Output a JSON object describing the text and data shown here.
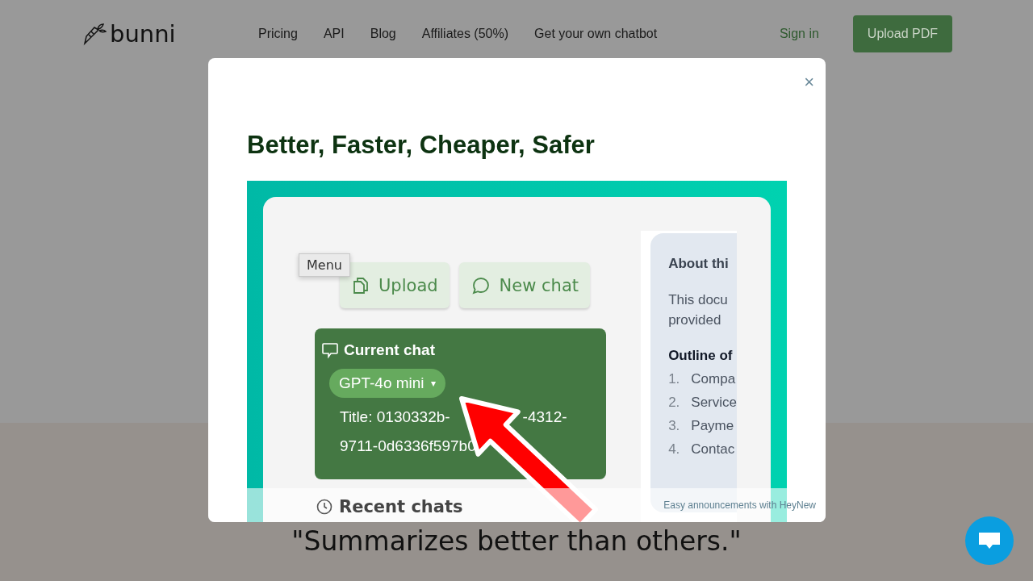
{
  "header": {
    "logo": "bunni",
    "nav": [
      "Pricing",
      "API",
      "Blog",
      "Affiliates (50%)",
      "Get your own chatbot"
    ],
    "sign_in": "Sign in",
    "upload_button": "Upload PDF"
  },
  "modal": {
    "close": "×",
    "title": "Better, Faster, Cheaper, Safer",
    "screenshot": {
      "menu_tooltip": "Menu",
      "buttons": [
        {
          "label": "Upload",
          "kind": "upload"
        },
        {
          "label": "New chat",
          "kind": "chat"
        }
      ],
      "current_chat": {
        "heading": "Current chat",
        "model": "GPT-4o mini",
        "caret": "▾",
        "title_parts": [
          "Title: 0130332b-",
          "-4312-",
          "9711-0d6336f597b0"
        ]
      },
      "recent_chats": "Recent chats",
      "about": {
        "heading": "About thi",
        "body": [
          "This docu",
          "provided"
        ],
        "outline_heading": "Outline of",
        "outline": [
          {
            "number": "1.",
            "text": "Compa"
          },
          {
            "number": "2.",
            "text": "Service"
          },
          {
            "number": "3.",
            "text": "Payme"
          },
          {
            "number": "4.",
            "text": "Contac"
          }
        ]
      }
    },
    "footer": "Easy announcements with HeyNew"
  },
  "quote": "\"Summarizes better than others.\""
}
